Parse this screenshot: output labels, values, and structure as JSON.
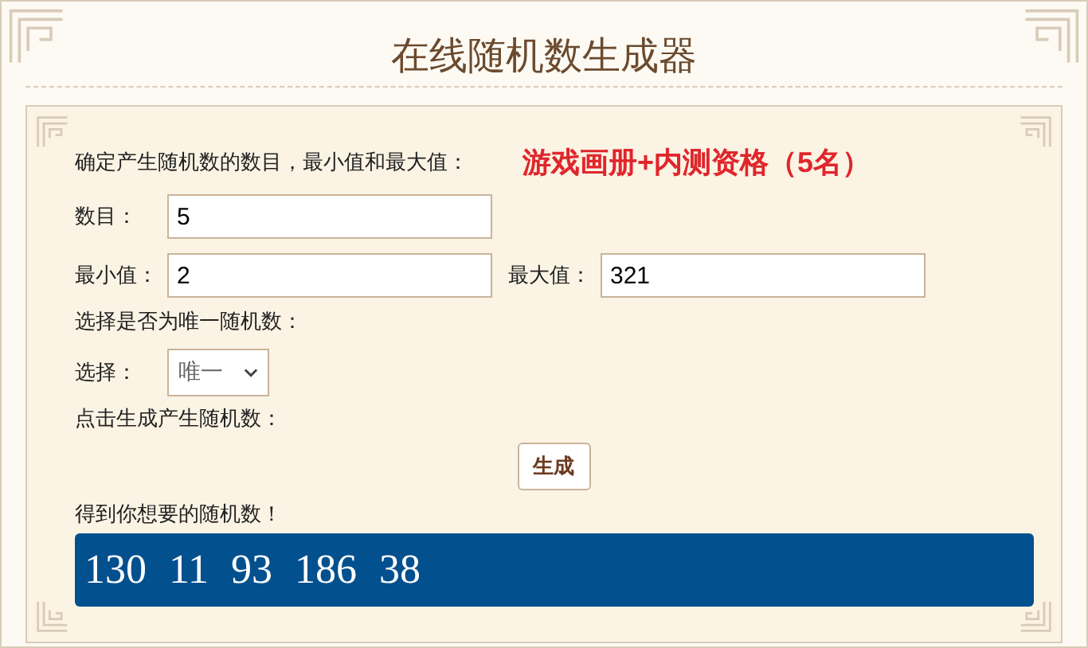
{
  "title": "在线随机数生成器",
  "intro": "确定产生随机数的数目，最小值和最大值：",
  "promo": "游戏画册+内测资格（5名）",
  "count": {
    "label": "数目：",
    "value": "5"
  },
  "min": {
    "label": "最小值：",
    "value": "2"
  },
  "max": {
    "label": "最大值：",
    "value": "321"
  },
  "unique_prompt": "选择是否为唯一随机数：",
  "choice": {
    "label": "选择：",
    "value": "唯一"
  },
  "generate_prompt": "点击生成产生随机数：",
  "generate_button": "生成",
  "result_label": "得到你想要的随机数！",
  "results": [
    "130",
    "11",
    "93",
    "186",
    "38"
  ]
}
